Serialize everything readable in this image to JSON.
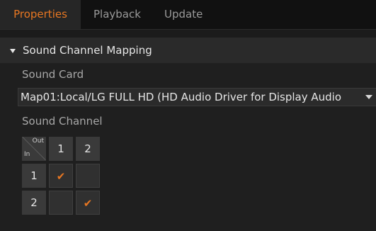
{
  "tabs": [
    {
      "label": "Properties",
      "active": true
    },
    {
      "label": "Playback",
      "active": false
    },
    {
      "label": "Update",
      "active": false
    }
  ],
  "section": {
    "title": "Sound Channel Mapping",
    "expanded": true
  },
  "sound_card": {
    "label": "Sound Card",
    "selected": "Map01:Local/LG FULL HD (HD Audio Driver for Display Audio"
  },
  "sound_channel": {
    "label": "Sound Channel",
    "corner_out": "Out",
    "corner_in": "In",
    "out_channels": [
      "1",
      "2"
    ],
    "in_channels": [
      "1",
      "2"
    ],
    "mapping": [
      [
        true,
        false
      ],
      [
        false,
        true
      ]
    ],
    "check_glyph": "✔"
  },
  "colors": {
    "accent": "#e87722",
    "background": "#1b1b1b",
    "panel": "#1f1f1f",
    "cell": "#3a3a3a"
  }
}
